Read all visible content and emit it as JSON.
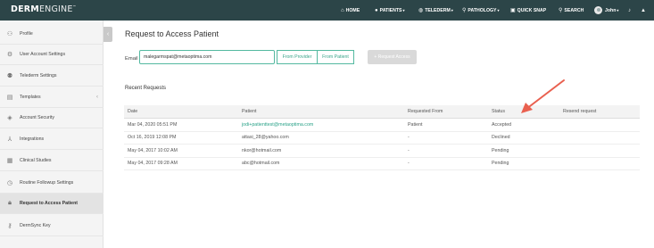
{
  "app": {
    "logo_bold": "DERM",
    "logo_light": "ENGINE",
    "logo_mark": "™"
  },
  "nav": {
    "home": "HOME",
    "patients": "PATIENTS",
    "telederm": "TELEDERM",
    "pathology": "PATHOLOGY",
    "quick_snap": "QUICK SNAP",
    "search": "SEARCH",
    "user": "John"
  },
  "sidebar": {
    "items": [
      {
        "label": "Profile",
        "icon": "people-icon"
      },
      {
        "label": "User Account Settings",
        "icon": "gear-icon"
      },
      {
        "label": "Telederm Settings",
        "icon": "user-gear-icon"
      },
      {
        "label": "Templates",
        "icon": "document-icon",
        "expandable": true
      },
      {
        "label": "Account Security",
        "icon": "shield-icon"
      },
      {
        "label": "Integrations",
        "icon": "network-icon"
      },
      {
        "label": "Clinical Studies",
        "icon": "studies-icon"
      },
      {
        "label": "Routine Followup Settings",
        "icon": "clock-icon"
      },
      {
        "label": "Request to Access Patient",
        "icon": "lock-icon",
        "active": true
      },
      {
        "label": "DermSync Key",
        "icon": "key-icon"
      }
    ]
  },
  "main": {
    "title": "Request to Access Patient",
    "email_label": "Email",
    "email_value": "malegarmspat@metaoptima.com",
    "from_provider": "From Provider",
    "from_patient": "From Patient",
    "request_button": "+ Request Access",
    "recent_title": "Recent Requests",
    "columns": [
      "Date",
      "Patient",
      "Requested From",
      "Status",
      "Resend request"
    ],
    "rows": [
      {
        "date": "Mar 04, 2020 05:51 PM",
        "patient": "jodi+patienttest@metaoptima.com",
        "from": "Patient",
        "status": "Accepted",
        "patient_link": true
      },
      {
        "date": "Oct 16, 2019 12:08 PM",
        "patient": "attasi_28@yahoo.com",
        "from": "-",
        "status": "Declined",
        "patient_link": false
      },
      {
        "date": "May 04, 2017 10:02 AM",
        "patient": "nkor@hotmail.com",
        "from": "-",
        "status": "Pending",
        "patient_link": false
      },
      {
        "date": "May 04, 2017 09:28 AM",
        "patient": "abc@hotmail.com",
        "from": "-",
        "status": "Pending",
        "patient_link": false
      }
    ]
  },
  "colors": {
    "topbar": "#2c4548",
    "accent": "#54b9a0",
    "link": "#2aa288",
    "annotation_arrow": "#e9604f"
  }
}
